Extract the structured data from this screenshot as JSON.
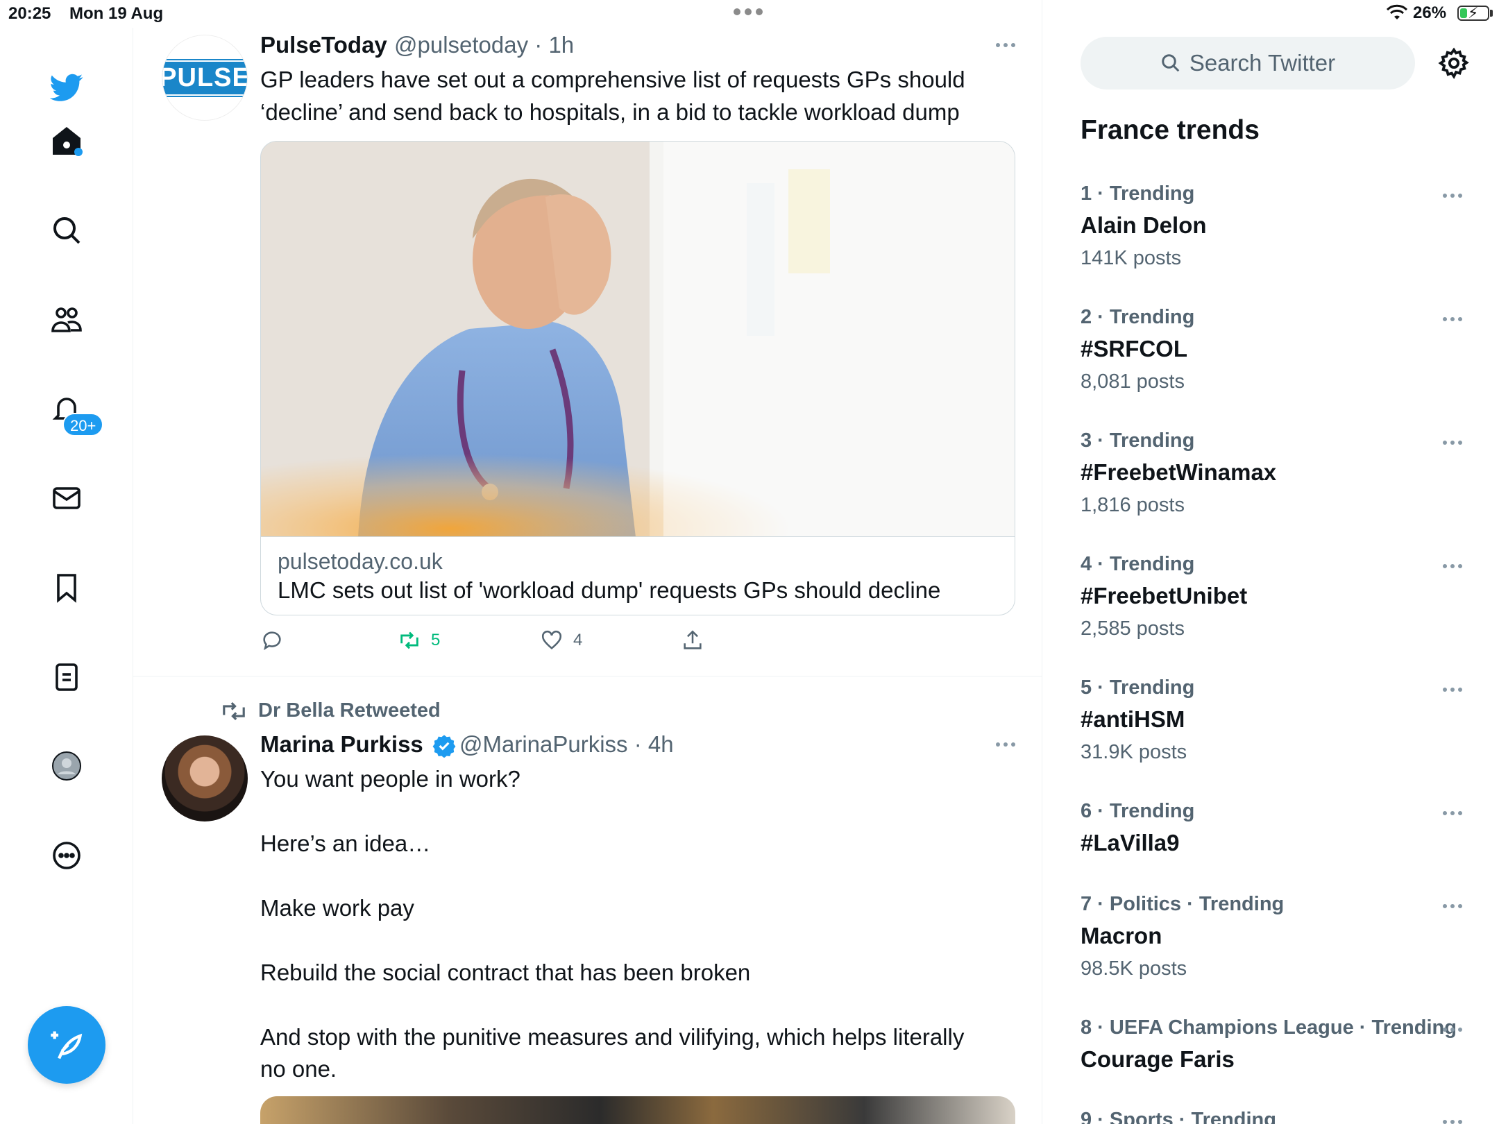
{
  "status_bar": {
    "time": "20:25",
    "date": "Mon 19 Aug",
    "battery": "26%",
    "battery_level": 0.26
  },
  "nav": {
    "notifications_badge": "20+",
    "items": [
      "twitter-logo",
      "home",
      "search",
      "communities",
      "notifications",
      "messages",
      "bookmarks",
      "lists",
      "profile",
      "more"
    ]
  },
  "tweet1": {
    "name": "PulseToday",
    "handle": "@pulsetoday · 1h",
    "avatar_text": "PULSE",
    "text_line1": "GP leaders have set out a comprehensive list of requests GPs should",
    "text_line2": "‘decline’ and send back to hospitals, in a bid to tackle workload dump",
    "card_domain": "pulsetoday.co.uk",
    "card_title": "LMC sets out list of 'workload dump' requests GPs should decline",
    "retweets": "5",
    "likes": "4"
  },
  "tweet2": {
    "retweeted_by": "Dr Bella Retweeted",
    "name": "Marina Purkiss",
    "handle": "@MarinaPurkiss · 4h",
    "lines": [
      "You want people in work?",
      "Here’s an idea…",
      "Make work pay",
      "Rebuild the social contract that has been broken",
      "And stop with the punitive measures and vilifying, which helps literally",
      "no one."
    ]
  },
  "sidebar": {
    "search_placeholder": "Search Twitter",
    "trends_title": "France trends",
    "trends": [
      {
        "meta": "1 · Trending",
        "name": "Alain Delon",
        "count": "141K posts"
      },
      {
        "meta": "2 · Trending",
        "name": "#SRFCOL",
        "count": "8,081 posts"
      },
      {
        "meta": "3 · Trending",
        "name": "#FreebetWinamax",
        "count": "1,816 posts"
      },
      {
        "meta": "4 · Trending",
        "name": "#FreebetUnibet",
        "count": "2,585 posts"
      },
      {
        "meta": "5 · Trending",
        "name": "#antiHSM",
        "count": "31.9K posts"
      },
      {
        "meta": "6 · Trending",
        "name": "#LaVilla9",
        "count": ""
      },
      {
        "meta": "7 · Politics · Trending",
        "name": "Macron",
        "count": "98.5K posts"
      },
      {
        "meta": "8 · UEFA Champions League · Trending",
        "name": "Courage Faris",
        "count": ""
      },
      {
        "meta": "9 · Sports · Trending",
        "name": "",
        "count": ""
      }
    ]
  },
  "colors": {
    "accent": "#1d9bf0",
    "retweet_green": "#00ba7c",
    "secondary_text": "#536471"
  }
}
